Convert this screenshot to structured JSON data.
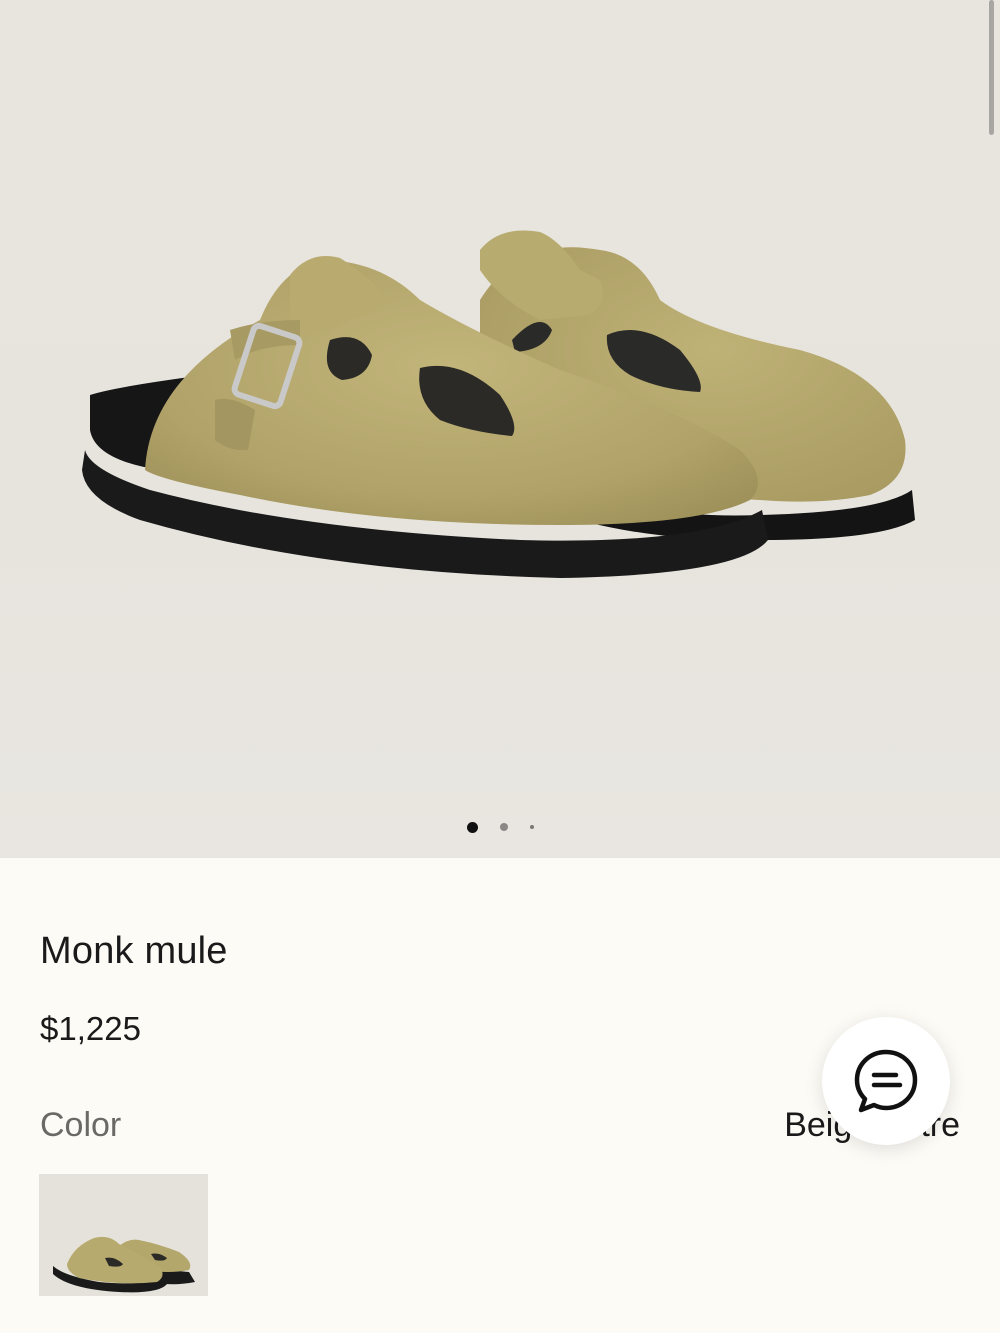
{
  "gallery": {
    "current_index": 1,
    "total_images": 3,
    "image_alt_icon": "product-photo"
  },
  "product": {
    "name": "Monk mule",
    "price": "$1,225"
  },
  "color": {
    "label": "Color",
    "selected_value": "Beige Antre",
    "swatch_icon": "color-swatch-thumbnail"
  },
  "chat": {
    "icon": "chat-bubble-icon"
  },
  "colors": {
    "background": "#fdfbf6",
    "suede": "#b6a86b",
    "sole": "#1c1c1c"
  }
}
